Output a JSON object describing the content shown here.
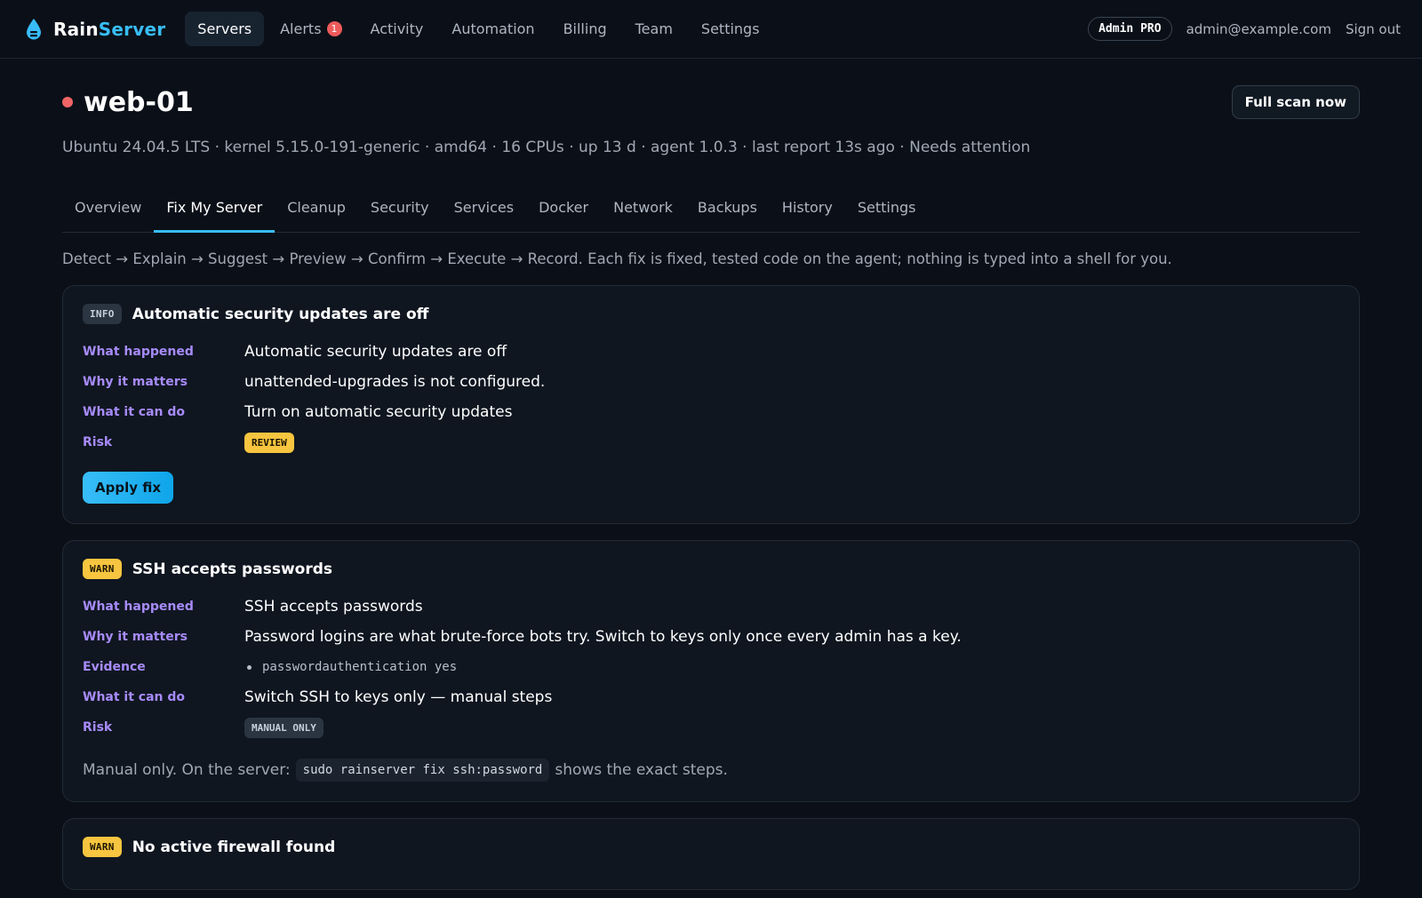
{
  "brand": {
    "part1": "Rain",
    "part2": "Server"
  },
  "nav": {
    "items": [
      {
        "label": "Servers",
        "active": true
      },
      {
        "label": "Alerts",
        "badge": "1"
      },
      {
        "label": "Activity"
      },
      {
        "label": "Automation"
      },
      {
        "label": "Billing"
      },
      {
        "label": "Team"
      },
      {
        "label": "Settings"
      }
    ]
  },
  "user": {
    "badge": "Admin PRO",
    "email": "admin@example.com",
    "signout": "Sign out"
  },
  "server": {
    "name": "web-01",
    "status_color": "#f06565",
    "info": "Ubuntu 24.04.5 LTS · kernel 5.15.0-191-generic · amd64 · 16 CPUs · up 13 d · agent 1.0.3 · last report 13s ago · Needs attention",
    "scan_label": "Full scan now"
  },
  "tabs": [
    {
      "label": "Overview"
    },
    {
      "label": "Fix My Server",
      "active": true
    },
    {
      "label": "Cleanup"
    },
    {
      "label": "Security"
    },
    {
      "label": "Services"
    },
    {
      "label": "Docker"
    },
    {
      "label": "Network"
    },
    {
      "label": "Backups"
    },
    {
      "label": "History"
    },
    {
      "label": "Settings"
    }
  ],
  "flow_text": "Detect → Explain → Suggest → Preview → Confirm → Execute → Record. Each fix is fixed, tested code on the agent; nothing is typed into a shell for you.",
  "labels": {
    "what_happened": "What happened",
    "why_it_matters": "Why it matters",
    "evidence": "Evidence",
    "what_it_can_do": "What it can do",
    "risk": "Risk"
  },
  "issues": [
    {
      "severity": "INFO",
      "title": "Automatic security updates are off",
      "what_happened": "Automatic security updates are off",
      "why_it_matters": "unattended-upgrades is not configured.",
      "what_it_can_do": "Turn on automatic security updates",
      "risk": "REVIEW",
      "action": "Apply fix"
    },
    {
      "severity": "WARN",
      "title": "SSH accepts passwords",
      "what_happened": "SSH accepts passwords",
      "why_it_matters": "Password logins are what brute-force bots try. Switch to keys only once every admin has a key.",
      "evidence": "passwordauthentication yes",
      "what_it_can_do": "Switch SSH to keys only — manual steps",
      "risk": "MANUAL ONLY",
      "manual_prefix": "Manual only. On the server:",
      "manual_command": "sudo rainserver fix ssh:password",
      "manual_suffix": "shows the exact steps."
    },
    {
      "severity": "WARN",
      "title": "No active firewall found"
    }
  ],
  "colors": {
    "accent": "#38bdf8",
    "label": "#a78bfa",
    "warn": "#f7c53f",
    "danger": "#f06565",
    "background": "#0b1018"
  }
}
